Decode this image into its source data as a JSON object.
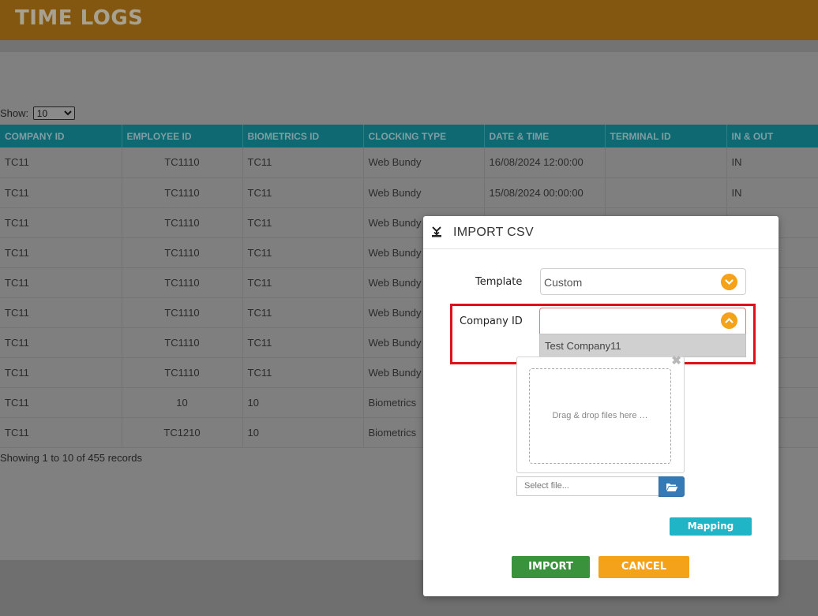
{
  "header": {
    "title": "TIME LOGS"
  },
  "show": {
    "label": "Show:",
    "value": "10"
  },
  "table": {
    "columns": [
      "COMPANY ID",
      "EMPLOYEE ID",
      "BIOMETRICS ID",
      "CLOCKING TYPE",
      "DATE & TIME",
      "TERMINAL ID",
      "IN & OUT"
    ],
    "rows": [
      [
        "TC11",
        "TC1110",
        "TC11",
        "Web Bundy",
        "16/08/2024 12:00:00",
        "",
        "IN"
      ],
      [
        "TC11",
        "TC1110",
        "TC11",
        "Web Bundy",
        "15/08/2024 00:00:00",
        "",
        "IN"
      ],
      [
        "TC11",
        "TC1110",
        "TC11",
        "Web Bundy",
        "",
        "",
        ""
      ],
      [
        "TC11",
        "TC1110",
        "TC11",
        "Web Bundy",
        "",
        "",
        ""
      ],
      [
        "TC11",
        "TC1110",
        "TC11",
        "Web Bundy",
        "",
        "",
        ""
      ],
      [
        "TC11",
        "TC1110",
        "TC11",
        "Web Bundy",
        "",
        "",
        ""
      ],
      [
        "TC11",
        "TC1110",
        "TC11",
        "Web Bundy",
        "",
        "",
        ""
      ],
      [
        "TC11",
        "TC1110",
        "TC11",
        "Web Bundy",
        "",
        "",
        ""
      ],
      [
        "TC11",
        "10",
        "10",
        "Biometrics",
        "",
        "",
        ""
      ],
      [
        "TC11",
        "TC1210",
        "10",
        "Biometrics",
        "",
        "",
        ""
      ]
    ],
    "footer": "Showing 1 to 10 of 455 records"
  },
  "modal": {
    "title": "IMPORT CSV",
    "template_label": "Template",
    "template_value": "Custom",
    "company_label": "Company ID",
    "company_value": "",
    "company_options": [
      "Test Company11"
    ],
    "dropzone_text": "Drag & drop files here …",
    "file_placeholder": "Select file...",
    "close_glyph": "✖",
    "mapping_label": "Mapping",
    "import_label": "IMPORT",
    "cancel_label": "CANCEL"
  },
  "colors": {
    "header_bg": "#83570f",
    "table_header_bg": "#0f6972",
    "accent_orange": "#f3a21a",
    "import_green": "#3a923c",
    "mapping_cyan": "#1fb5c7",
    "highlight_red": "#e0101a"
  }
}
